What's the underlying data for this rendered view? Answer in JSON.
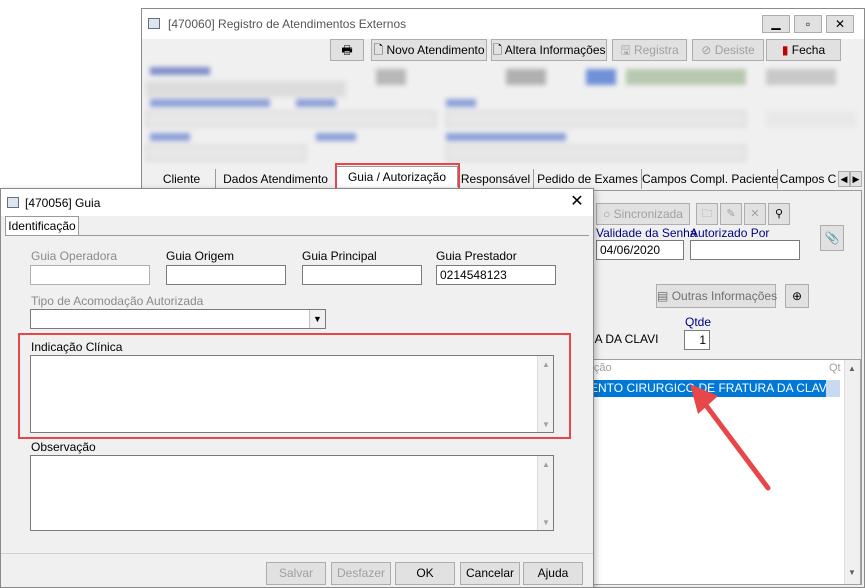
{
  "back_window": {
    "title": "[470060]  Registro de Atendimentos Externos",
    "toolbar": {
      "novo_atendimento": "Novo Atendimento",
      "altera_informacoes": "Altera Informações",
      "registra": "Registra",
      "desiste": "Desiste",
      "fecha": "Fecha"
    },
    "tabs": [
      "Cliente",
      "Dados Atendimento",
      "Guia / Autorização",
      "Responsável",
      "Pedido de Exames",
      "Campos Compl. Paciente",
      "Campos C"
    ],
    "sincronizada": "Sincronizada",
    "validade_label": "Validade da Senha",
    "autorizado_label": "Autorizado Por",
    "validade_value": "04/06/2020",
    "outras_informacoes": "Outras Informações",
    "qtde_label": "Qtde",
    "qtde_value": "1",
    "procedimento_value": "TURA DA CLAVI",
    "grid_header": "minação",
    "grid_header_qt": "Qt",
    "grid_row": "AMENTO CIRURGICO DE FRATURA DA CLAVI"
  },
  "dialog": {
    "title": "[470056]  Guia",
    "tab": "Identificação",
    "guia_operadora_label": "Guia Operadora",
    "guia_origem_label": "Guia Origem",
    "guia_principal_label": "Guia Principal",
    "guia_prestador_label": "Guia Prestador",
    "guia_operadora_value": "",
    "guia_origem_value": "",
    "guia_principal_value": "",
    "guia_prestador_value": "0214548123",
    "tipo_acomodacao_label": "Tipo de Acomodação Autorizada",
    "indicacao_clinica_label": "Indicação Clínica",
    "observacao_label": "Observação",
    "buttons": {
      "salvar": "Salvar",
      "desfazer": "Desfazer",
      "ok": "OK",
      "cancelar": "Cancelar",
      "ajuda": "Ajuda"
    }
  },
  "colors": {
    "highlight_red": "#e8474a",
    "selection_blue": "#0078d7"
  }
}
